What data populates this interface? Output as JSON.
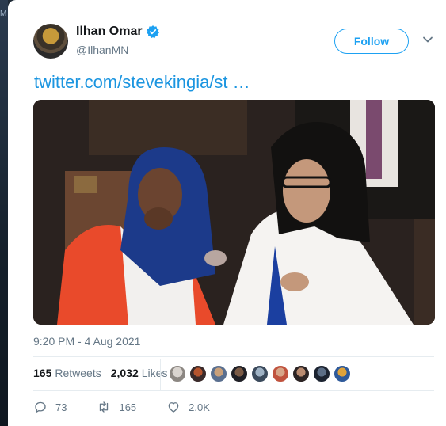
{
  "user": {
    "name": "Ilhan Omar",
    "handle": "@IlhanMN"
  },
  "follow_label": "Follow",
  "tweet": {
    "link_text": "twitter.com/stevekingia/st …",
    "timestamp": "9:20 PM - 4 Aug 2021"
  },
  "stats": {
    "retweets_count": "165",
    "retweets_label": "Retweets",
    "likes_count": "2,032",
    "likes_label": "Likes"
  },
  "actions": {
    "replies": "73",
    "retweets": "165",
    "likes": "2.0K"
  },
  "colors": {
    "accent": "#1da1f2",
    "link": "#1b95e0",
    "muted": "#657786"
  },
  "icons": [
    "verified-badge-icon",
    "chevron-down-icon",
    "reply-icon",
    "retweet-icon",
    "like-icon"
  ]
}
